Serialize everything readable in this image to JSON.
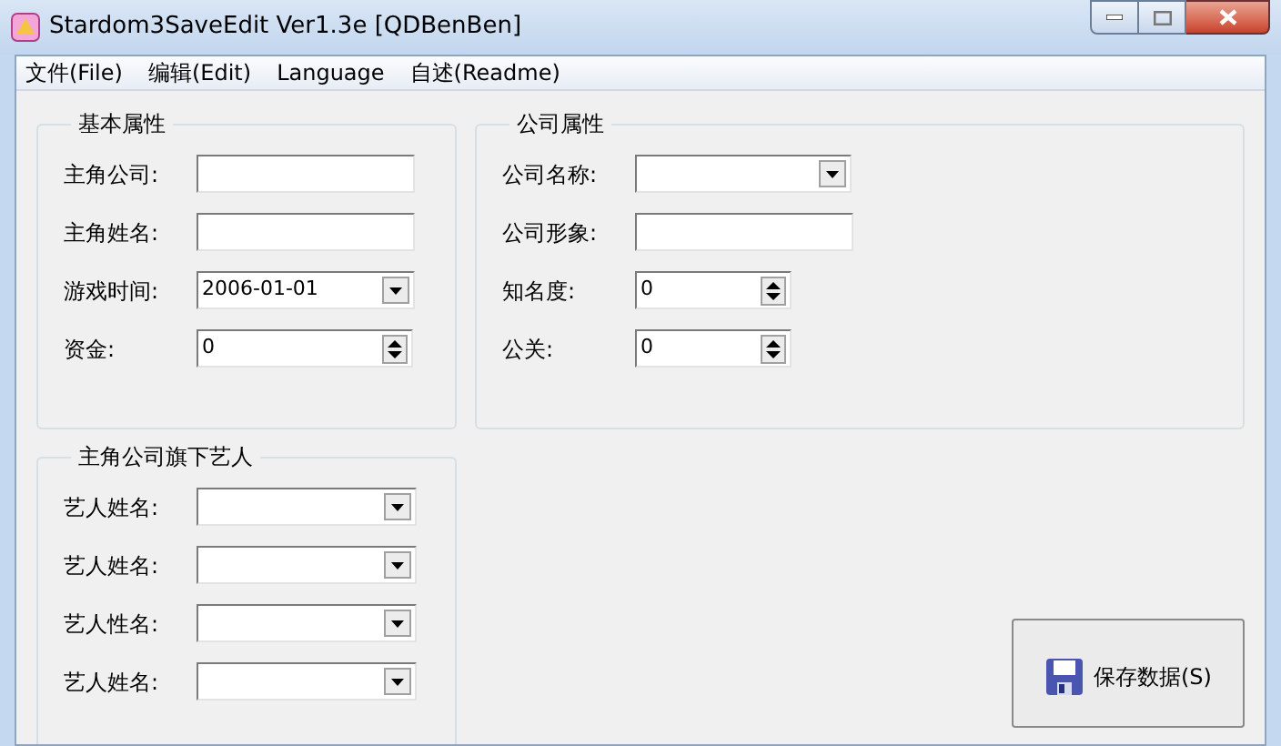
{
  "window": {
    "title": "Stardom3SaveEdit Ver1.3e [QDBenBen]"
  },
  "menu": [
    "文件(File)",
    "编辑(Edit)",
    "Language",
    "自述(Readme)"
  ],
  "groups": [
    {
      "title": "基本属性",
      "fields": [
        {
          "label": "主角公司:",
          "kind": "text"
        },
        {
          "label": "主角姓名:",
          "kind": "text"
        },
        {
          "label": "游戏时间:",
          "kind": "combo",
          "value": "2006-01-01"
        },
        {
          "label": "资金:",
          "kind": "spin",
          "value": "0"
        }
      ]
    },
    {
      "title": "公司属性",
      "fields": [
        {
          "label": "公司名称:",
          "kind": "combo"
        },
        {
          "label": "公司形象:",
          "kind": "text"
        },
        {
          "label": "知名度:",
          "kind": "spin",
          "value": "0"
        },
        {
          "label": "公关:",
          "kind": "spin",
          "value": "0"
        }
      ]
    },
    {
      "title": "主角公司旗下艺人",
      "fields": [
        {
          "label": "艺人姓名:",
          "kind": "combo"
        },
        {
          "label": "艺人姓名:",
          "kind": "combo"
        },
        {
          "label": "艺人性名:",
          "kind": "combo"
        },
        {
          "label": "艺人姓名:",
          "kind": "combo"
        }
      ]
    }
  ],
  "save_button": {
    "label": "保存数据(S)"
  }
}
